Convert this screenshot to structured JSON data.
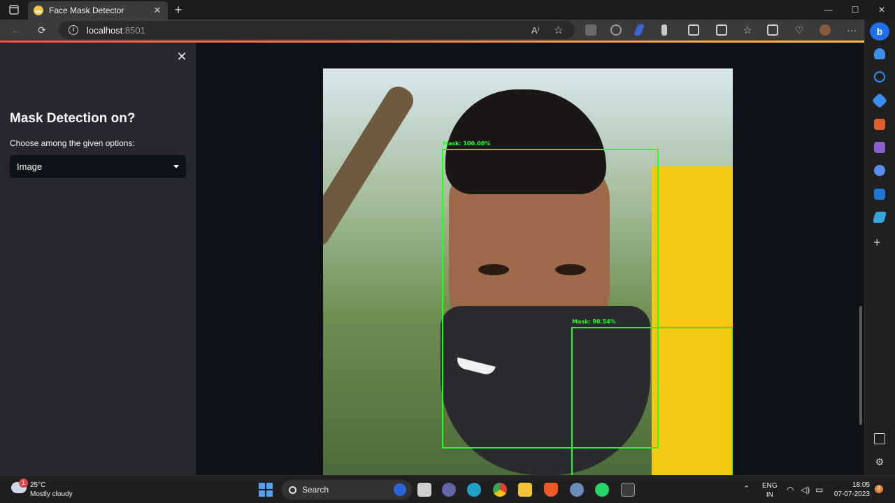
{
  "browser": {
    "tab_title": "Face Mask Detector",
    "new_tab_symbol": "+",
    "url_host": "localhost",
    "url_port": ":8501",
    "window_controls": {
      "minimize": "—",
      "maximize": "☐",
      "close": "✕"
    },
    "read_aloud": "A⁾",
    "more": "···"
  },
  "sidebar": {
    "close_symbol": "✕",
    "heading": "Mask Detection on?",
    "select_label": "Choose among the given options:",
    "select_value": "Image"
  },
  "detections": [
    {
      "label": "Mask: 100.00%"
    },
    {
      "label": "Mask: 90.54%"
    }
  ],
  "taskbar": {
    "weather_badge": "1",
    "temperature": "25°C",
    "condition": "Mostly cloudy",
    "search_placeholder": "Search",
    "lang_line1": "ENG",
    "lang_line2": "IN",
    "time": "18:05",
    "date": "07-07-2023",
    "notification_count": "8"
  },
  "colors": {
    "app_bg": "#0e1117",
    "sidebar_bg": "#262730",
    "bbox": "#22ff22",
    "accent": "#ff4b4b"
  }
}
